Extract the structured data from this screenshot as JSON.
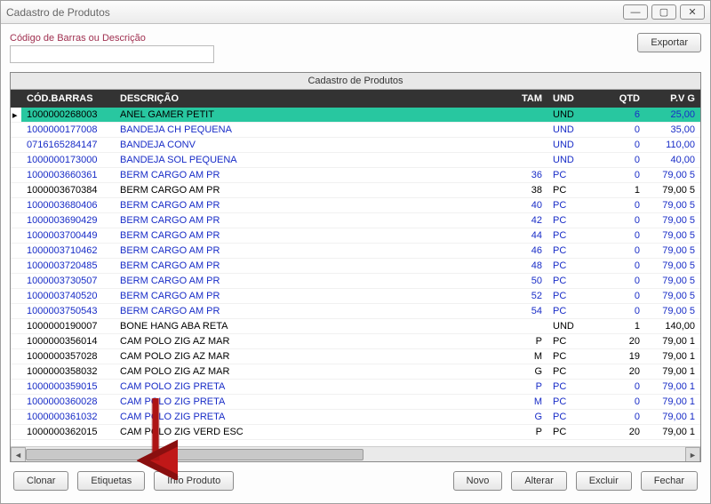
{
  "window": {
    "title": "Cadastro de Produtos"
  },
  "search": {
    "label": "Código de Barras ou Descrição",
    "value": ""
  },
  "buttons": {
    "export": "Exportar",
    "clonar": "Clonar",
    "etiquetas": "Etiquetas",
    "info": "Info Produto",
    "novo": "Novo",
    "alterar": "Alterar",
    "excluir": "Excluir",
    "fechar": "Fechar"
  },
  "grid": {
    "caption": "Cadastro de Produtos",
    "headers": {
      "cod": "CÓD.BARRAS",
      "desc": "DESCRIÇÃO",
      "tam": "TAM",
      "und": "UND",
      "qtd": "QTD",
      "pv": "P.V G"
    },
    "rows": [
      {
        "sel": true,
        "link": true,
        "cod": "1000000268003",
        "desc": "ANEL GAMER PETIT",
        "tam": "",
        "und": "UND",
        "qtd": "6",
        "pv": "25,00"
      },
      {
        "sel": false,
        "link": true,
        "cod": "1000000177008",
        "desc": "BANDEJA CH PEQUENA",
        "tam": "",
        "und": "UND",
        "qtd": "0",
        "pv": "35,00"
      },
      {
        "sel": false,
        "link": true,
        "cod": "0716165284147",
        "desc": "BANDEJA CONV",
        "tam": "",
        "und": "UND",
        "qtd": "0",
        "pv": "110,00"
      },
      {
        "sel": false,
        "link": true,
        "cod": "1000000173000",
        "desc": "BANDEJA SOL PEQUENA",
        "tam": "",
        "und": "UND",
        "qtd": "0",
        "pv": "40,00"
      },
      {
        "sel": false,
        "link": true,
        "cod": "1000003660361",
        "desc": "BERM CARGO AM PR",
        "tam": "36",
        "und": "PC",
        "qtd": "0",
        "pv": "79,00 5"
      },
      {
        "sel": false,
        "link": false,
        "cod": "1000003670384",
        "desc": "BERM CARGO AM PR",
        "tam": "38",
        "und": "PC",
        "qtd": "1",
        "pv": "79,00 5"
      },
      {
        "sel": false,
        "link": true,
        "cod": "1000003680406",
        "desc": "BERM CARGO AM PR",
        "tam": "40",
        "und": "PC",
        "qtd": "0",
        "pv": "79,00 5"
      },
      {
        "sel": false,
        "link": true,
        "cod": "1000003690429",
        "desc": "BERM CARGO AM PR",
        "tam": "42",
        "und": "PC",
        "qtd": "0",
        "pv": "79,00 5"
      },
      {
        "sel": false,
        "link": true,
        "cod": "1000003700449",
        "desc": "BERM CARGO AM PR",
        "tam": "44",
        "und": "PC",
        "qtd": "0",
        "pv": "79,00 5"
      },
      {
        "sel": false,
        "link": true,
        "cod": "1000003710462",
        "desc": "BERM CARGO AM PR",
        "tam": "46",
        "und": "PC",
        "qtd": "0",
        "pv": "79,00 5"
      },
      {
        "sel": false,
        "link": true,
        "cod": "1000003720485",
        "desc": "BERM CARGO AM PR",
        "tam": "48",
        "und": "PC",
        "qtd": "0",
        "pv": "79,00 5"
      },
      {
        "sel": false,
        "link": true,
        "cod": "1000003730507",
        "desc": "BERM CARGO AM PR",
        "tam": "50",
        "und": "PC",
        "qtd": "0",
        "pv": "79,00 5"
      },
      {
        "sel": false,
        "link": true,
        "cod": "1000003740520",
        "desc": "BERM CARGO AM PR",
        "tam": "52",
        "und": "PC",
        "qtd": "0",
        "pv": "79,00 5"
      },
      {
        "sel": false,
        "link": true,
        "cod": "1000003750543",
        "desc": "BERM CARGO AM PR",
        "tam": "54",
        "und": "PC",
        "qtd": "0",
        "pv": "79,00 5"
      },
      {
        "sel": false,
        "link": false,
        "cod": "1000000190007",
        "desc": "BONE HANG ABA RETA",
        "tam": "",
        "und": "UND",
        "qtd": "1",
        "pv": "140,00"
      },
      {
        "sel": false,
        "link": false,
        "cod": "1000000356014",
        "desc": "CAM POLO ZIG AZ MAR",
        "tam": "P",
        "und": "PC",
        "qtd": "20",
        "pv": "79,00 1"
      },
      {
        "sel": false,
        "link": false,
        "cod": "1000000357028",
        "desc": "CAM POLO ZIG AZ MAR",
        "tam": "M",
        "und": "PC",
        "qtd": "19",
        "pv": "79,00 1"
      },
      {
        "sel": false,
        "link": false,
        "cod": "1000000358032",
        "desc": "CAM POLO ZIG AZ MAR",
        "tam": "G",
        "und": "PC",
        "qtd": "20",
        "pv": "79,00 1"
      },
      {
        "sel": false,
        "link": true,
        "cod": "1000000359015",
        "desc": "CAM POLO ZIG PRETA",
        "tam": "P",
        "und": "PC",
        "qtd": "0",
        "pv": "79,00 1"
      },
      {
        "sel": false,
        "link": true,
        "cod": "1000000360028",
        "desc": "CAM POLO ZIG PRETA",
        "tam": "M",
        "und": "PC",
        "qtd": "0",
        "pv": "79,00 1"
      },
      {
        "sel": false,
        "link": true,
        "cod": "1000000361032",
        "desc": "CAM POLO ZIG PRETA",
        "tam": "G",
        "und": "PC",
        "qtd": "0",
        "pv": "79,00 1"
      },
      {
        "sel": false,
        "link": false,
        "cod": "1000000362015",
        "desc": "CAM POLO ZIG VERD ESC",
        "tam": "P",
        "und": "PC",
        "qtd": "20",
        "pv": "79,00 1"
      }
    ]
  }
}
